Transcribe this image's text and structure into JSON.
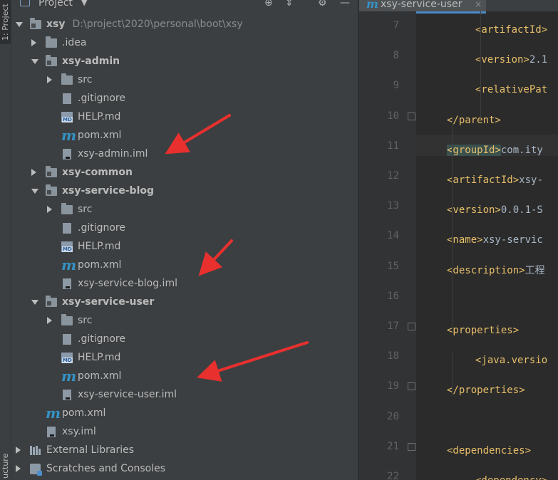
{
  "left_strip": {
    "project_tab": "1: Project",
    "structure_tab": "ucture"
  },
  "panel": {
    "title": "Project"
  },
  "tree": [
    {
      "label": "xsy",
      "path": "D:\\project\\2020\\personal\\boot\\xsy",
      "bold": true,
      "icon": "module-folder-icon",
      "arrow": "down",
      "indent": 0
    },
    {
      "label": ".idea",
      "icon": "folder-icon",
      "arrow": "right",
      "indent": 1
    },
    {
      "label": "xsy-admin",
      "bold": true,
      "icon": "module-folder-icon",
      "arrow": "down",
      "indent": 1
    },
    {
      "label": "src",
      "icon": "folder-icon",
      "arrow": "right",
      "indent": 2
    },
    {
      "label": ".gitignore",
      "icon": "file-icon",
      "indent": 2
    },
    {
      "label": "HELP.md",
      "icon": "markdown-icon",
      "indent": 2
    },
    {
      "label": "pom.xml",
      "icon": "maven-icon",
      "indent": 2
    },
    {
      "label": "xsy-admin.iml",
      "icon": "iml-file-icon",
      "indent": 2
    },
    {
      "label": "xsy-common",
      "bold": true,
      "icon": "module-folder-icon",
      "arrow": "right",
      "indent": 1
    },
    {
      "label": "xsy-service-blog",
      "bold": true,
      "icon": "module-folder-icon",
      "arrow": "down",
      "indent": 1
    },
    {
      "label": "src",
      "icon": "folder-icon",
      "arrow": "right",
      "indent": 2
    },
    {
      "label": ".gitignore",
      "icon": "file-icon",
      "indent": 2
    },
    {
      "label": "HELP.md",
      "icon": "markdown-icon",
      "indent": 2
    },
    {
      "label": "pom.xml",
      "icon": "maven-icon",
      "indent": 2
    },
    {
      "label": "xsy-service-blog.iml",
      "icon": "iml-file-icon",
      "indent": 2
    },
    {
      "label": "xsy-service-user",
      "bold": true,
      "icon": "module-folder-icon",
      "arrow": "down",
      "indent": 1
    },
    {
      "label": "src",
      "icon": "folder-icon",
      "arrow": "right",
      "indent": 2
    },
    {
      "label": ".gitignore",
      "icon": "file-icon",
      "indent": 2
    },
    {
      "label": "HELP.md",
      "icon": "markdown-icon",
      "indent": 2
    },
    {
      "label": "pom.xml",
      "icon": "maven-icon",
      "indent": 2
    },
    {
      "label": "xsy-service-user.iml",
      "icon": "iml-file-icon",
      "indent": 2
    },
    {
      "label": "pom.xml",
      "icon": "maven-icon",
      "indent": 1
    },
    {
      "label": "xsy.iml",
      "icon": "iml-file-icon",
      "indent": 1
    },
    {
      "label": "External Libraries",
      "icon": "library-icon",
      "arrow": "right",
      "indent": 0
    },
    {
      "label": "Scratches and Consoles",
      "icon": "scratches-icon",
      "arrow": "right",
      "indent": 0
    }
  ],
  "editor": {
    "tab": {
      "label": "xsy-service-user",
      "icon": "maven-icon",
      "close": "×"
    },
    "lines": [
      {
        "num": "7",
        "fold": false,
        "indent": 2,
        "parts": [
          {
            "t": "tag",
            "v": "<artifactId>"
          },
          {
            "t": "txt",
            "v": ""
          }
        ]
      },
      {
        "num": "8",
        "fold": false,
        "indent": 2,
        "parts": [
          {
            "t": "tag",
            "v": "<version>"
          },
          {
            "t": "txt",
            "v": "2.1"
          }
        ]
      },
      {
        "num": "9",
        "fold": false,
        "indent": 2,
        "parts": [
          {
            "t": "tag",
            "v": "<relativePat"
          }
        ]
      },
      {
        "num": "10",
        "fold": true,
        "indent": 1,
        "parts": [
          {
            "t": "tag",
            "v": "</parent>"
          }
        ]
      },
      {
        "num": "11",
        "fold": false,
        "indent": 1,
        "current": true,
        "parts": [
          {
            "t": "taghl",
            "v": "<groupId>"
          },
          {
            "t": "txt",
            "v": "com.ity"
          }
        ]
      },
      {
        "num": "12",
        "fold": false,
        "indent": 1,
        "parts": [
          {
            "t": "tag",
            "v": "<artifactId>"
          },
          {
            "t": "txt",
            "v": "xsy-"
          }
        ]
      },
      {
        "num": "13",
        "fold": false,
        "indent": 1,
        "parts": [
          {
            "t": "tag",
            "v": "<version>"
          },
          {
            "t": "txt",
            "v": "0.0.1-S"
          }
        ]
      },
      {
        "num": "14",
        "fold": false,
        "indent": 1,
        "parts": [
          {
            "t": "tag",
            "v": "<name>"
          },
          {
            "t": "txt",
            "v": "xsy-servic"
          }
        ]
      },
      {
        "num": "15",
        "fold": false,
        "indent": 1,
        "parts": [
          {
            "t": "tag",
            "v": "<description>"
          },
          {
            "t": "txt",
            "v": "工程"
          }
        ]
      },
      {
        "num": "16",
        "fold": false,
        "indent": 1,
        "parts": []
      },
      {
        "num": "17",
        "fold": true,
        "indent": 1,
        "parts": [
          {
            "t": "tag",
            "v": "<properties>"
          }
        ]
      },
      {
        "num": "18",
        "fold": false,
        "indent": 2,
        "parts": [
          {
            "t": "tag",
            "v": "<java.versio"
          }
        ]
      },
      {
        "num": "19",
        "fold": true,
        "indent": 1,
        "parts": [
          {
            "t": "tag",
            "v": "</properties>"
          }
        ]
      },
      {
        "num": "20",
        "fold": false,
        "indent": 1,
        "parts": []
      },
      {
        "num": "21",
        "fold": true,
        "indent": 1,
        "parts": [
          {
            "t": "tag",
            "v": "<dependencies>"
          }
        ]
      },
      {
        "num": "22",
        "fold": false,
        "indent": 2,
        "parts": [
          {
            "t": "tag",
            "v": "<dependency>"
          }
        ]
      }
    ]
  },
  "colors": {
    "panel_bg": "#3c3f41",
    "editor_bg": "#2b2b2b",
    "tag": "#e8bf6a",
    "annotation_arrow": "#e8302e",
    "maven": "#3592c4"
  }
}
